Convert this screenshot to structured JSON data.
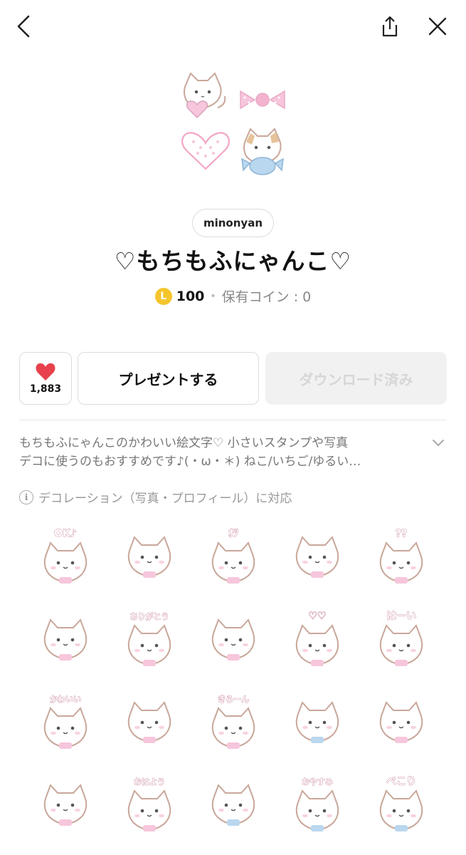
{
  "header": {
    "back_icon": "chevron-left-icon",
    "share_icon": "share-icon",
    "close_icon": "close-icon"
  },
  "product": {
    "author": "minonyan",
    "title": "♡もちもふにゃんこ♡",
    "coin_symbol": "L",
    "price": "100",
    "owned_coins": "保有コイン : 0"
  },
  "actions": {
    "like_count": "1,883",
    "gift_label": "プレゼントする",
    "download_label": "ダウンロード済み"
  },
  "description": {
    "line1": "もちもふにゃんこのかわいい絵文字♡ 小さいスタンプや写真",
    "line2": "デコに使うのもおすすめです♪(・ω・＊) ねこ/いちご/ゆるい…"
  },
  "notice": {
    "icon": "info-icon",
    "text": "デコレーション（写真・プロフィール）に対応"
  },
  "colors": {
    "heart": "#e8414c",
    "coin": "#f5c52c",
    "pink": "#f6c6dc",
    "sticker_outline": "#c9a79a"
  },
  "stickers": [
    {
      "text": "OK♪",
      "accent": "#f6c6dc"
    },
    {
      "text": "",
      "accent": "#f6c6dc"
    },
    {
      "text": "ｵﾂ",
      "accent": "#f6c6dc"
    },
    {
      "text": "",
      "accent": "#f6c6dc"
    },
    {
      "text": "??",
      "accent": "#f6c6dc"
    },
    {
      "text": "",
      "accent": "#f6c6dc"
    },
    {
      "text": "ありがとう",
      "accent": "#f6c6dc"
    },
    {
      "text": "",
      "accent": "#f6c6dc"
    },
    {
      "text": "♡♡",
      "accent": "#f6c6dc"
    },
    {
      "text": "はーい",
      "accent": "#f6c6dc"
    },
    {
      "text": "かわいい",
      "accent": "#f6c6dc"
    },
    {
      "text": "",
      "accent": "#f6c6dc"
    },
    {
      "text": "きらーん",
      "accent": "#f6c6dc"
    },
    {
      "text": "",
      "accent": "#b9d7ef"
    },
    {
      "text": "",
      "accent": "#f6c6dc"
    },
    {
      "text": "",
      "accent": "#f6c6dc"
    },
    {
      "text": "おはよう",
      "accent": "#f6c6dc"
    },
    {
      "text": "",
      "accent": "#b9d7ef"
    },
    {
      "text": "おやすみ",
      "accent": "#b9d7ef"
    },
    {
      "text": "ぺこり",
      "accent": "#b9d7ef"
    }
  ]
}
